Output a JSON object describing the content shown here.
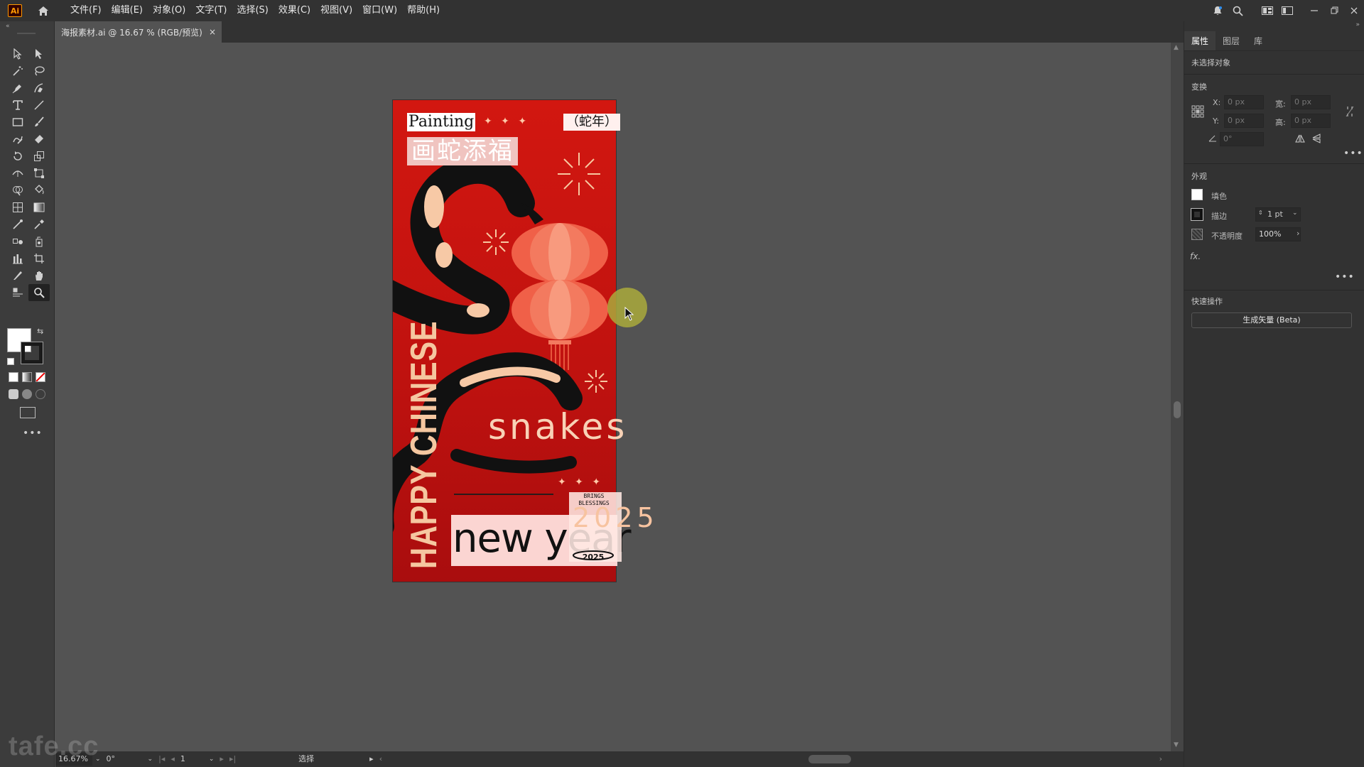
{
  "app": {
    "logo_text": "Ai",
    "menus": [
      "文件(F)",
      "编辑(E)",
      "对象(O)",
      "文字(T)",
      "选择(S)",
      "效果(C)",
      "视图(V)",
      "窗口(W)",
      "帮助(H)"
    ]
  },
  "document_tab": {
    "title": "海报素材.ai @ 16.67 % (RGB/预览)",
    "close": "×"
  },
  "poster": {
    "painting": "Painting",
    "stars": "✦ ✦ ✦",
    "year_tag": "（蛇年）",
    "chinese_title": "画蛇添福",
    "vertical": "HAPPY CHINESE",
    "snakes": "snakes",
    "new_year": "new year",
    "brings": "BRINGS\nBLESSINGS",
    "year_big": "2025",
    "year_small": "2025",
    "colors": {
      "background": "#c0120f",
      "accent": "#f5c7a0"
    }
  },
  "properties_panel": {
    "tabs": [
      "属性",
      "图层",
      "库"
    ],
    "no_selection": "未选择对象",
    "transform_title": "变换",
    "x_label": "X:",
    "x_value": "0 px",
    "y_label": "Y:",
    "y_value": "0 px",
    "w_label": "宽:",
    "w_value": "0 px",
    "h_label": "高:",
    "h_value": "0 px",
    "angle_value": "0°",
    "appearance_title": "外观",
    "fill_label": "填色",
    "stroke_label": "描边",
    "stroke_value": "1 pt",
    "opacity_label": "不透明度",
    "opacity_value": "100%",
    "fx_label": "fx.",
    "quick_actions_title": "快速操作",
    "generate_button": "生成矢量 (Beta)"
  },
  "status_bar": {
    "zoom": "16.67%",
    "rotation": "0°",
    "artboard": "1",
    "tool": "选择"
  },
  "watermark": "tafe.cc"
}
